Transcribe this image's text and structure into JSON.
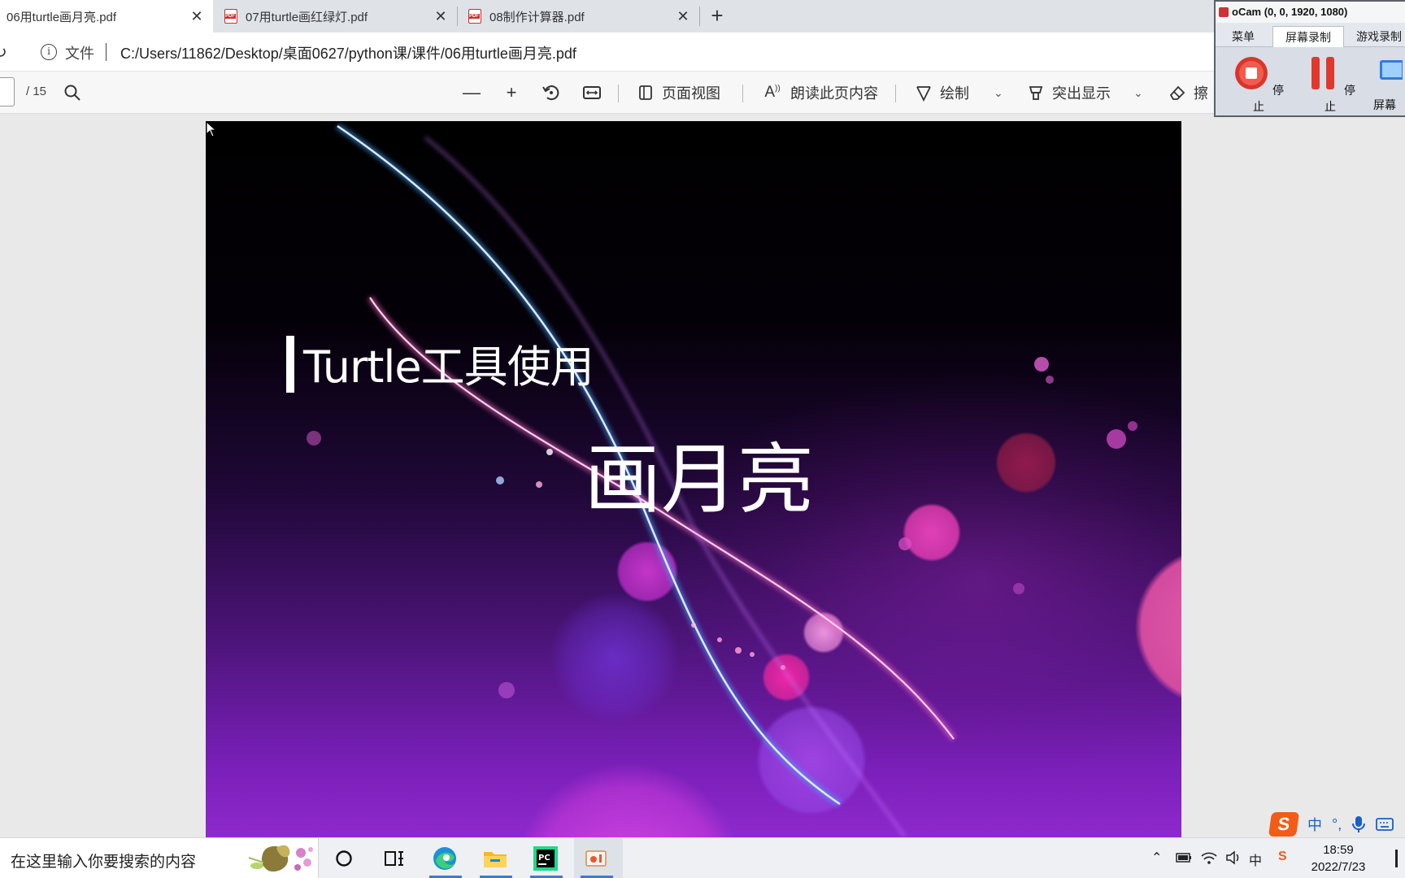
{
  "tabs": [
    {
      "title": "06用turtle画月亮.pdf",
      "active": true
    },
    {
      "title": "07用turtle画红绿灯.pdf",
      "active": false
    },
    {
      "title": "08制作计算器.pdf",
      "active": false
    }
  ],
  "address": {
    "label": "文件",
    "url": "C:/Users/11862/Desktop/桌面0627/python课/课件/06用turtle画月亮.pdf"
  },
  "toolbar": {
    "page_total": "/ 15",
    "page_view": "页面视图",
    "read_aloud": "朗读此页内容",
    "draw": "绘制",
    "highlight": "突出显示",
    "erase": "擦"
  },
  "slide": {
    "subtitle": "Turtle工具使用",
    "title": "画月亮"
  },
  "ocam": {
    "title": "oCam (0, 0, 1920, 1080)",
    "tabs": [
      "菜单",
      "屏幕录制",
      "游戏录制"
    ],
    "buttons": [
      "停止",
      "停止",
      "屏幕"
    ]
  },
  "taskbar": {
    "search_placeholder": "在这里输入你要搜索的内容",
    "time": "18:59",
    "date": "2022/7/23"
  },
  "ime": {
    "logo": "S",
    "mode": "中",
    "punct": "°,"
  }
}
